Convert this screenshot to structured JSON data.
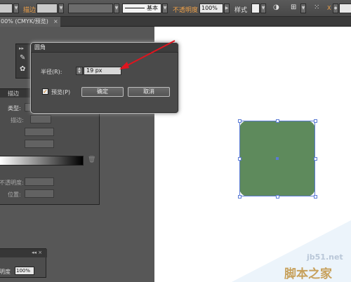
{
  "control_bar": {
    "stroke_label": "描边",
    "stroke_style_label": "基本",
    "opacity_label": "不透明度",
    "opacity_value": "100%",
    "style_label": "样式"
  },
  "document_tab": {
    "title": "00% (CMYK/预览)",
    "close": "×"
  },
  "stroke_panel": {
    "tab_label": "描边",
    "type_label": "类型:",
    "stroke_label": "描边:"
  },
  "lower_panel": {
    "opacity_label": "不透明度:",
    "position_label": "位置:"
  },
  "bottom_panel": {
    "opacity_label": "明度",
    "opacity_value": "100%"
  },
  "dialog": {
    "title": "圆角",
    "radius_label": "半径(R):",
    "radius_value": "19 px",
    "preview_label": "预览(P)",
    "preview_checked": true,
    "ok_label": "确定",
    "cancel_label": "取消"
  },
  "watermark": {
    "site": "jb51.net",
    "brand": "脚本之家"
  },
  "colors": {
    "shape_fill": "#5e8a5c",
    "selection": "#5b7bd5",
    "highlight_label": "#f0a24a",
    "annotation_arrow": "#e0141e"
  }
}
